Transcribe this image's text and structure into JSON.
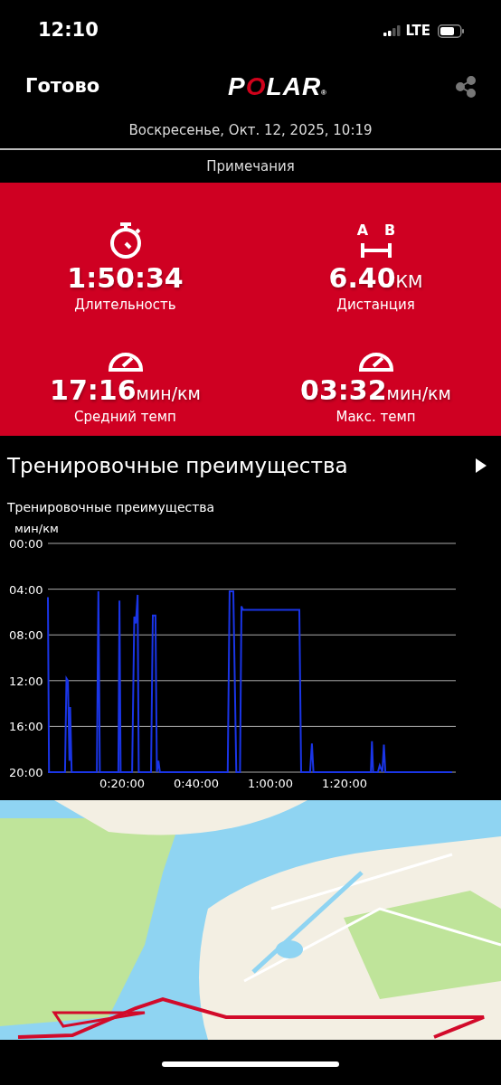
{
  "status_bar": {
    "time": "12:10",
    "network": "LTE"
  },
  "nav": {
    "done": "Готово",
    "logo": "POLAR",
    "logo_mark": "®"
  },
  "date": "Воскресенье, Окт. 12, 2025, 10:19",
  "notes": "Примечания",
  "distance_icon_labels": [
    "A",
    "B"
  ],
  "stats": [
    {
      "kind": "stopwatch",
      "value": "1:50:34",
      "label": "Длительность"
    },
    {
      "kind": "distance",
      "value": "6.40",
      "unit": "КМ",
      "label": "Дистанция"
    },
    {
      "kind": "gauge",
      "value": "17:16",
      "unit": "мин/км",
      "label": "Средний темп"
    },
    {
      "kind": "gauge",
      "value": "03:32",
      "unit": "мин/км",
      "label": "Макс. темп"
    }
  ],
  "section": {
    "title": "Тренировочные преимущества",
    "chart_data": {
      "type": "line",
      "grid": true,
      "title": "Тренировочные преимущества",
      "ylabel": "мин/км",
      "xlim": [
        0,
        110
      ],
      "ylim": [
        20,
        0
      ],
      "yticks": [
        {
          "value": 0,
          "label": "00:00"
        },
        {
          "value": 4,
          "label": "04:00"
        },
        {
          "value": 8,
          "label": "08:00"
        },
        {
          "value": 12,
          "label": "12:00"
        },
        {
          "value": 16,
          "label": "16:00"
        },
        {
          "value": 20,
          "label": "20:00"
        }
      ],
      "xticks": [
        {
          "value": 20,
          "label": "0:20:00"
        },
        {
          "value": 40,
          "label": "0:40:00"
        },
        {
          "value": 60,
          "label": "1:00:00"
        },
        {
          "value": 80,
          "label": "1:20:00"
        }
      ],
      "x": [
        0,
        0.3,
        4.6,
        5,
        5.4,
        5.8,
        6,
        6.4,
        13.2,
        13.6,
        14,
        19,
        19.3,
        19.6,
        22.7,
        23.3,
        23.7,
        24.2,
        24.5,
        27.8,
        28.3,
        29,
        29.4,
        29.8,
        30.2,
        48.5,
        49,
        50,
        50.8,
        51.8,
        52.2,
        52.6,
        67.8,
        68.3,
        70.7,
        71.2,
        71.6,
        87.1,
        87.4,
        87.7,
        89,
        89.5,
        90.2,
        90.6,
        91,
        109
      ],
      "series": [
        {
          "color": "#1a35e6",
          "values": [
            4.7,
            20,
            20,
            11.8,
            12,
            19,
            14.3,
            20,
            20,
            4.2,
            20,
            20,
            5,
            20,
            20,
            6.4,
            7,
            4.5,
            20,
            20,
            6.3,
            6.3,
            20,
            19,
            20,
            20,
            4.2,
            4.2,
            20,
            20,
            5.5,
            5.8,
            5.8,
            20,
            20,
            17.5,
            20,
            20,
            17.3,
            20,
            20,
            19.4,
            20,
            17.6,
            20,
            20
          ]
        }
      ]
    }
  }
}
